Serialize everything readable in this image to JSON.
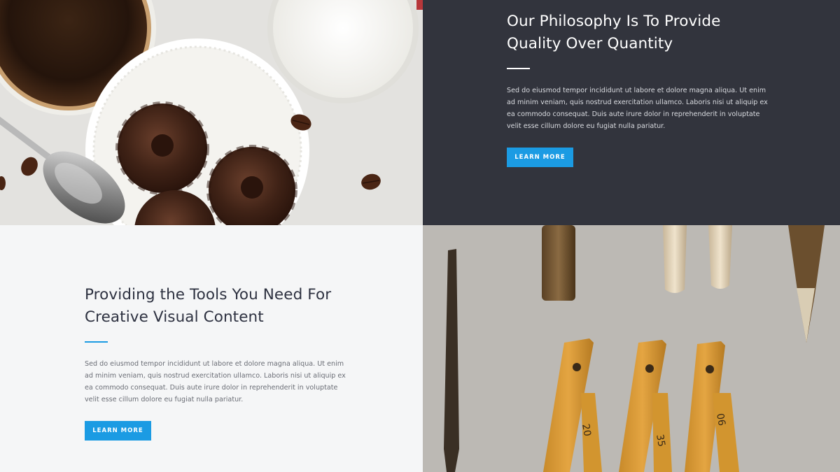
{
  "colors": {
    "accent": "#1b9be3",
    "dark_panel": "#32343d",
    "light_panel": "#f5f6f7",
    "heading_dark": "#2d3140",
    "body_dark": "#6a6d75",
    "heading_light": "#ffffff",
    "body_light": "#d9dbe0"
  },
  "top_section": {
    "heading_line1": "Our Philosophy Is To Provide",
    "heading_line2": "Quality Over Quantity",
    "body": "Sed do eiusmod tempor incididunt ut labore et dolore magna aliqua. Ut enim ad minim veniam, quis nostrud exercitation ullamco. Laboris nisi ut aliquip ex ea commodo consequat. Duis aute irure dolor in reprehenderit in voluptate velit esse cillum dolore eu fugiat nulla pariatur.",
    "button_label": "LEARN MORE",
    "image_subject": "coffee-and-pastries-photo"
  },
  "bottom_section": {
    "heading_line1": "Providing the Tools You Need For",
    "heading_line2": "Creative Visual Content",
    "body": "Sed do eiusmod tempor incididunt ut labore et dolore magna aliqua. Ut enim ad minim veniam, quis nostrud exercitation ullamco. Laboris nisi ut aliquip ex ea commodo consequat. Duis aute irure dolor in reprehenderit in voluptate velit esse cillum dolore eu fugiat nulla pariatur.",
    "button_label": "LEARN MORE",
    "image_subject": "tools-and-folding-rulers-photo"
  }
}
